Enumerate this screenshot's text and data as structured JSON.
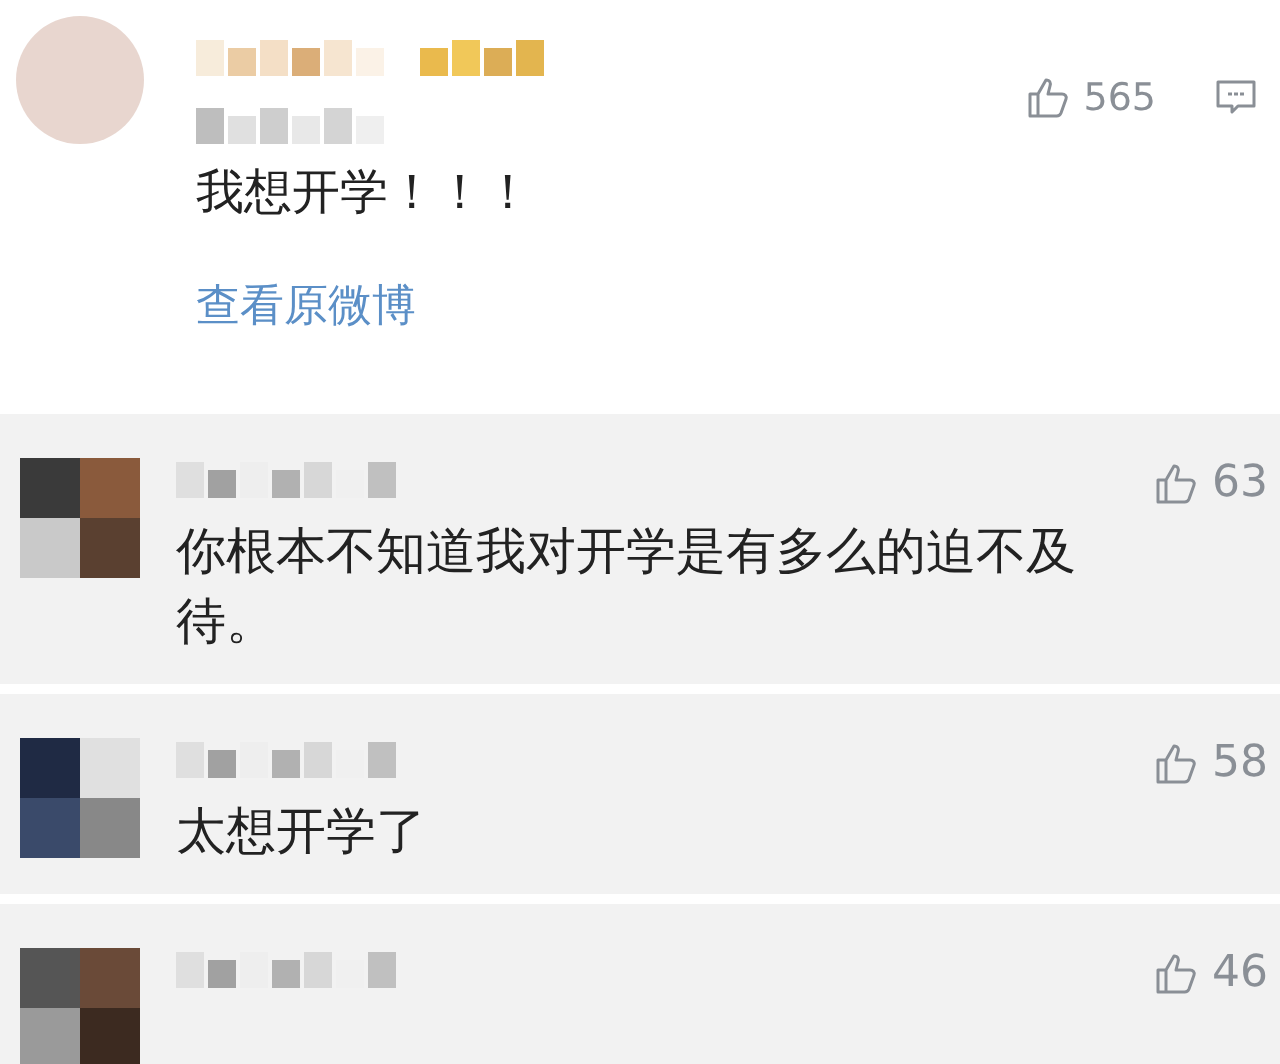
{
  "post": {
    "text": "我想开学！！！",
    "link": "查看原微博",
    "likes": "565"
  },
  "comments": [
    {
      "likes": "63",
      "text": "你根本不知道我对开学是有多么的迫不及待。"
    },
    {
      "likes": "58",
      "text": "太想开学了"
    },
    {
      "likes": "46"
    }
  ]
}
